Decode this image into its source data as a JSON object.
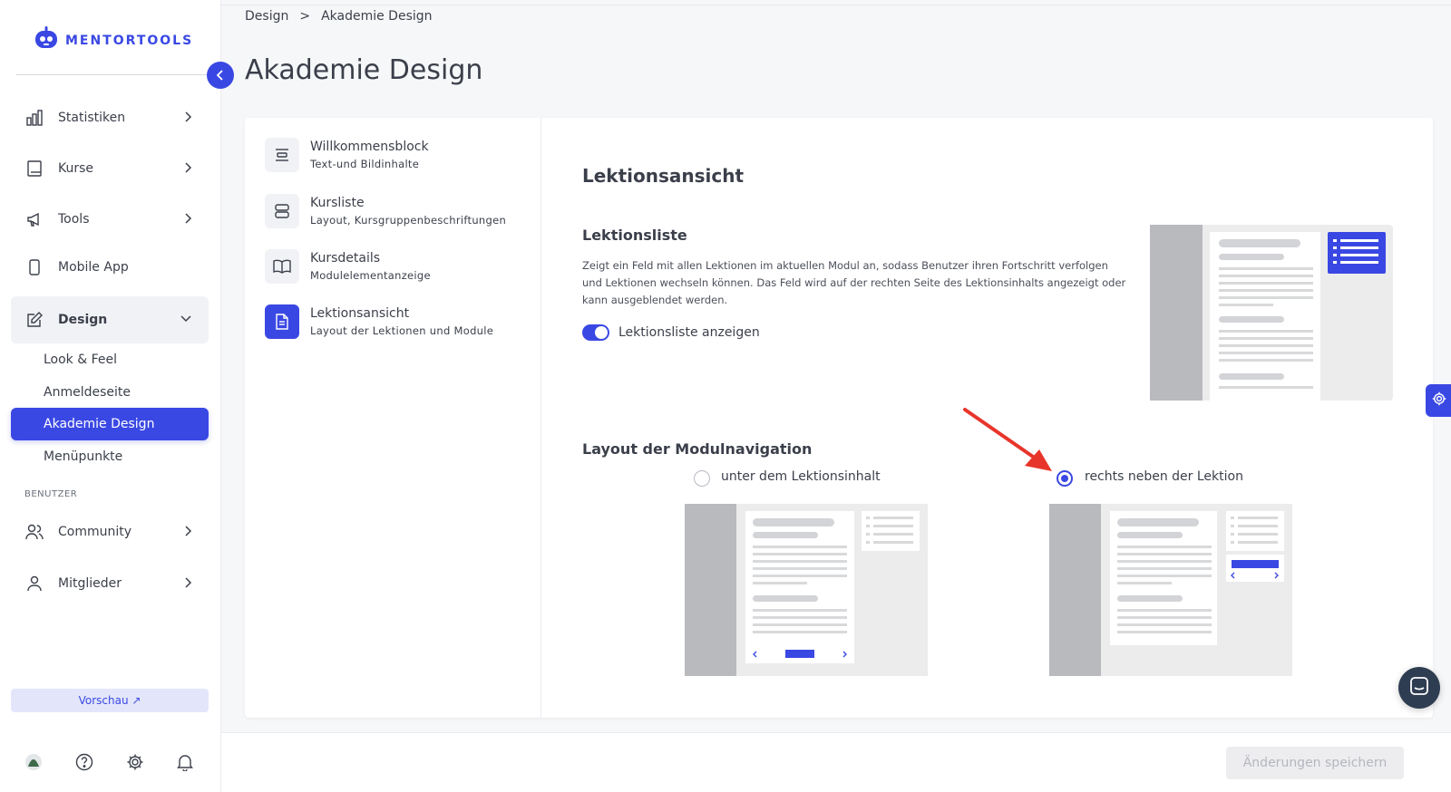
{
  "app": {
    "logo_text": "MENTORTOOLS"
  },
  "sidebar": {
    "items": [
      {
        "label": "Statistiken"
      },
      {
        "label": "Kurse"
      },
      {
        "label": "Tools"
      },
      {
        "label": "Mobile App"
      },
      {
        "label": "Design"
      }
    ],
    "design_subitems": [
      {
        "label": "Look & Feel"
      },
      {
        "label": "Anmeldeseite"
      },
      {
        "label": "Akademie Design"
      },
      {
        "label": "Menüpunkte"
      }
    ],
    "section_label": "BENUTZER",
    "user_items": [
      {
        "label": "Community"
      },
      {
        "label": "Mitglieder"
      }
    ],
    "preview_label": "Vorschau ↗"
  },
  "breadcrumb": {
    "parent": "Design",
    "separator": ">",
    "current": "Akademie Design"
  },
  "page": {
    "title": "Akademie Design"
  },
  "settings_menu": [
    {
      "title": "Willkommensblock",
      "subtitle": "Text-und Bildinhalte"
    },
    {
      "title": "Kursliste",
      "subtitle": "Layout, Kursgruppenbeschriftungen"
    },
    {
      "title": "Kursdetails",
      "subtitle": "Modulelementanzeige"
    },
    {
      "title": "Lektionsansicht",
      "subtitle": "Layout der Lektionen und Module"
    }
  ],
  "panel": {
    "title": "Lektionsansicht",
    "lesson_list": {
      "heading": "Lektionsliste",
      "description": "Zeigt ein Feld mit allen Lektionen im aktuellen Modul an, sodass Benutzer ihren Fortschritt verfolgen und Lektionen wechseln können. Das Feld wird auf der rechten Seite des Lektionsinhalts angezeigt oder kann ausgeblendet werden.",
      "toggle_label": "Lektionsliste anzeigen",
      "toggle_on": true
    },
    "module_nav": {
      "heading": "Layout der Modulnavigation",
      "options": [
        {
          "label": "unter dem Lektionsinhalt",
          "selected": false
        },
        {
          "label": "rechts neben der Lektion",
          "selected": true
        }
      ]
    }
  },
  "footer": {
    "save_label": "Änderungen speichern"
  },
  "colors": {
    "accent": "#3a48e3",
    "annotation_arrow": "#e8352b"
  }
}
